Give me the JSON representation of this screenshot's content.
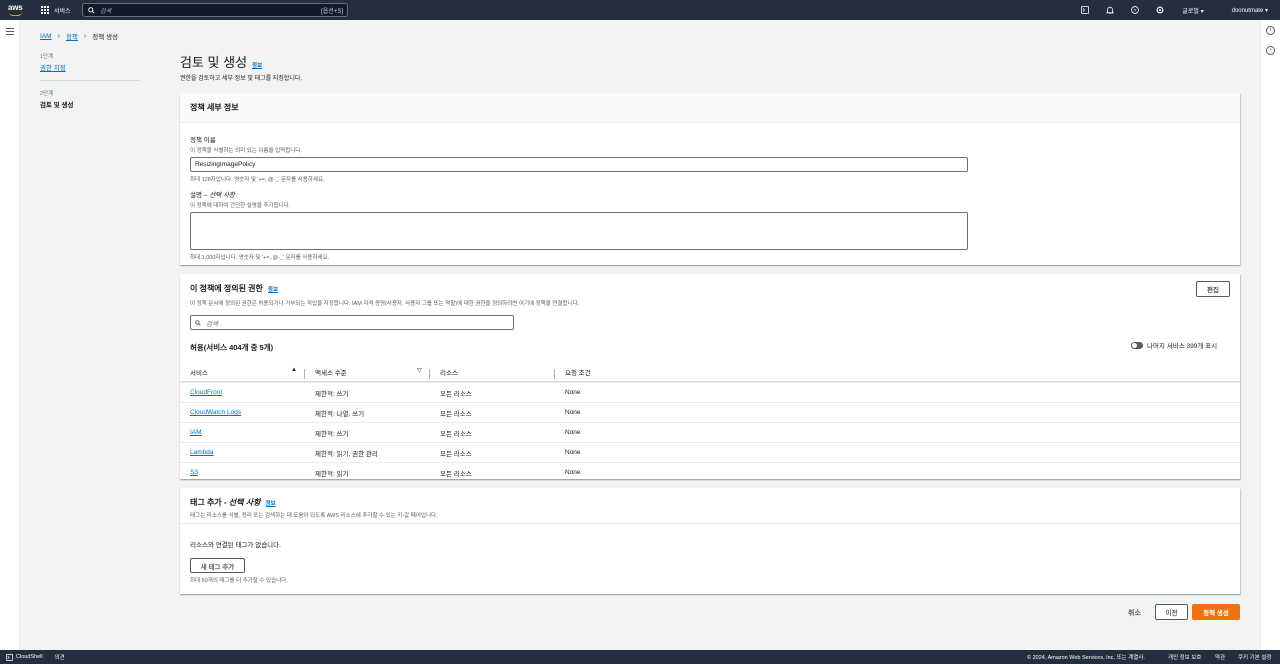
{
  "topbar": {
    "logo_text": "aws",
    "services_label": "서비스",
    "search_placeholder": "검색",
    "search_shortcut": "[옵션+S]",
    "region": "글로벌",
    "account": "doonutmate"
  },
  "breadcrumb": {
    "items": [
      "IAM",
      "정책",
      "정책 생성"
    ]
  },
  "steps": [
    {
      "num": "1단계",
      "label": "권한 지정"
    },
    {
      "num": "2단계",
      "label": "검토 및 생성"
    }
  ],
  "page": {
    "title": "검토 및 생성",
    "info": "정보",
    "description": "권한을 검토하고 세부 정보 및 태그를 지정합니다."
  },
  "details": {
    "header": "정책 세부 정보",
    "name_label": "정책 이름",
    "name_hint": "이 정책을 식별하는 의미 있는 이름을 입력합니다.",
    "name_value": "ResizingImagePolicy",
    "name_constraint": "최대 128자입니다. 영숫자 및 '+=,.@-_' 문자를 사용하세요.",
    "desc_label": "설명 –",
    "desc_optional": "선택 사항",
    "desc_hint": "이 정책에 대하여 간단한 설명을 추가합니다.",
    "desc_constraint": "최대 1,000자입니다. 영숫자 및 '+=,.@-_' 문자를 사용하세요."
  },
  "permissions": {
    "header": "이 정책에 정의된 권한",
    "info": "정보",
    "description": "이 정책 문서에 정의된 권한은 허용되거나 거부되는 작업을 지정합니다. IAM 자격 증명(사용자, 사용자 그룹 또는 역할)에 대한 권한을 정의하려면 여기에 정책을 연결합니다.",
    "edit_label": "편집",
    "search_placeholder": "검색",
    "allow_title": "허용(서비스 404개 중 5개)",
    "toggle_label": "나머지 서비스 399개 표시",
    "columns": [
      "서비스",
      "액세스 수준",
      "리소스",
      "요청 조건"
    ],
    "rows": [
      {
        "service": "CloudFront",
        "access": "제한적: 쓰기",
        "resource": "모든 리소스",
        "condition": "None"
      },
      {
        "service": "CloudWatch Logs",
        "access": "제한적: 나열, 쓰기",
        "resource": "모든 리소스",
        "condition": "None"
      },
      {
        "service": "IAM",
        "access": "제한적: 쓰기",
        "resource": "모든 리소스",
        "condition": "None"
      },
      {
        "service": "Lambda",
        "access": "제한적: 읽기, 권한 관리",
        "resource": "모든 리소스",
        "condition": "None"
      },
      {
        "service": "S3",
        "access": "제한적: 읽기",
        "resource": "모든 리소스",
        "condition": "None"
      }
    ]
  },
  "tags": {
    "header": "태그 추가 -",
    "header_optional": "선택 사항",
    "info": "정보",
    "description": "태그는 리소스를 식별, 정리 또는 검색하는 데 도움이 되도록 AWS 리소스에 추가할 수 있는 키-값 페어입니다.",
    "empty": "리소스와 연결된 태그가 없습니다.",
    "add_label": "새 태그 추가",
    "limit": "최대 50개의 태그를 더 추가할 수 있습니다."
  },
  "actions": {
    "cancel": "취소",
    "previous": "이전",
    "create": "정책 생성"
  },
  "footer": {
    "cloudshell": "CloudShell",
    "feedback": "의견",
    "copyright": "© 2024, Amazon Web Services, Inc. 또는 계열사.",
    "privacy": "개인 정보 보호",
    "terms": "약관",
    "cookies": "쿠키 기본 설정"
  }
}
